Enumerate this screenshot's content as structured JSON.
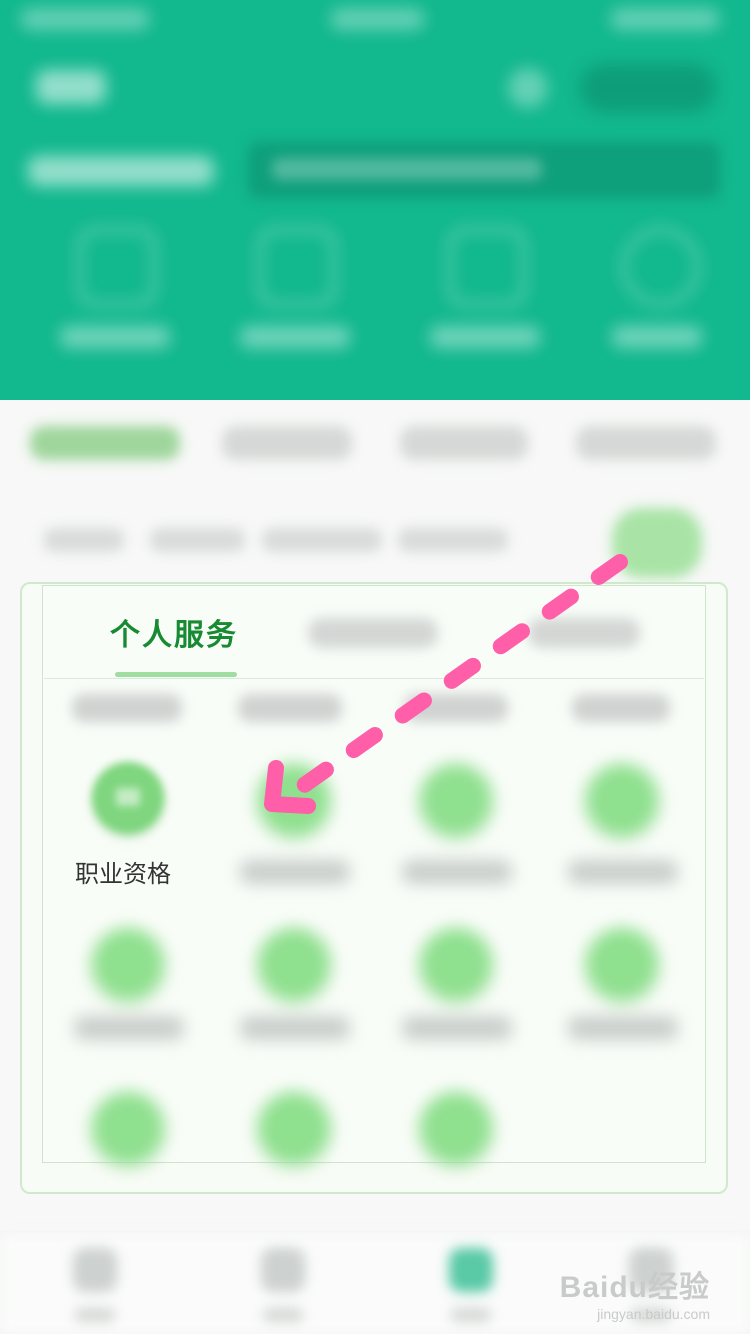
{
  "page": {
    "accent_color": "#12b88e",
    "service_green": "#178a32",
    "annotation_color": "#ff5fa8"
  },
  "service_panel": {
    "active_tab_label": "个人服务",
    "highlighted_service": {
      "label": "职业资格",
      "icon": "certificate-icon"
    }
  },
  "annotation": {
    "type": "dashed-arrow",
    "points_to": "service-item-2"
  },
  "watermark": {
    "brand": "Baidu经验",
    "sub": "jingyan.baidu.com"
  }
}
